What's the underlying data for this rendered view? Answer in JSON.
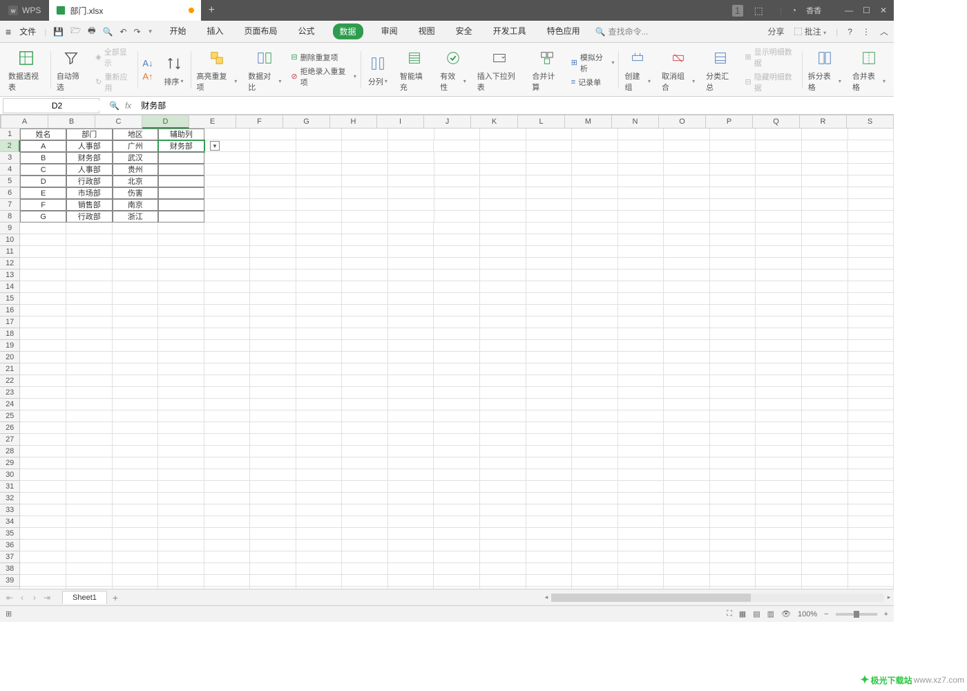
{
  "title": {
    "app": "WPS",
    "tab": "部门.xlsx"
  },
  "win": {
    "user": "香香"
  },
  "menu": {
    "file": "文件",
    "tabs": [
      "开始",
      "插入",
      "页面布局",
      "公式",
      "数据",
      "审阅",
      "视图",
      "安全",
      "开发工具",
      "特色应用"
    ],
    "active": "数据",
    "search": "查找命令...",
    "share": "分享",
    "annotate": "批注"
  },
  "qat": {
    "items": [
      "save",
      "open",
      "print",
      "preview",
      "undo",
      "redo"
    ]
  },
  "ribbon": {
    "pivot": "数据透视表",
    "autofilter": "自动筛选",
    "showall": "全部显示",
    "reapply": "重新应用",
    "sort_az": "A→Z",
    "sort_za": "Z→A",
    "sort": "排序",
    "highlight_dup": "高亮重复项",
    "data_compare": "数据对比",
    "delete_dup": "删除重复项",
    "reject_dup": "拒绝录入重复项",
    "text_to_cols": "分列",
    "smart_fill": "智能填充",
    "validation": "有效性",
    "insert_dropdown": "插入下拉列表",
    "consolidate": "合并计算",
    "simulate": "模拟分析",
    "record": "记录单",
    "group": "创建组",
    "ungroup": "取消组合",
    "subtotal": "分类汇总",
    "show_detail": "显示明细数据",
    "hide_detail": "隐藏明细数据",
    "split_table": "拆分表格",
    "merge_table": "合并表格"
  },
  "formulaBar": {
    "nameBox": "D2",
    "fxValue": "财务部"
  },
  "columns": [
    "A",
    "B",
    "C",
    "D",
    "E",
    "F",
    "G",
    "H",
    "I",
    "J",
    "K",
    "L",
    "M",
    "N",
    "O",
    "P",
    "Q",
    "R",
    "S"
  ],
  "grid": {
    "headers": [
      "姓名",
      "部门",
      "地区",
      "辅助列"
    ],
    "rows": [
      {
        "a": "A",
        "b": "人事部",
        "c": "广州",
        "d": "财务部"
      },
      {
        "a": "B",
        "b": "财务部",
        "c": "武汉",
        "d": ""
      },
      {
        "a": "C",
        "b": "人事部",
        "c": "贵州",
        "d": ""
      },
      {
        "a": "D",
        "b": "行政部",
        "c": "北京",
        "d": ""
      },
      {
        "a": "E",
        "b": "市场部",
        "c": "伤害",
        "d": ""
      },
      {
        "a": "F",
        "b": "销售部",
        "c": "南京",
        "d": ""
      },
      {
        "a": "G",
        "b": "行政部",
        "c": "浙江",
        "d": ""
      }
    ],
    "selectedCell": "D2"
  },
  "sheet": {
    "name": "Sheet1"
  },
  "status": {
    "zoom": "100%"
  },
  "watermark": {
    "site": "极光下载站",
    "url": "www.xz7.com"
  }
}
